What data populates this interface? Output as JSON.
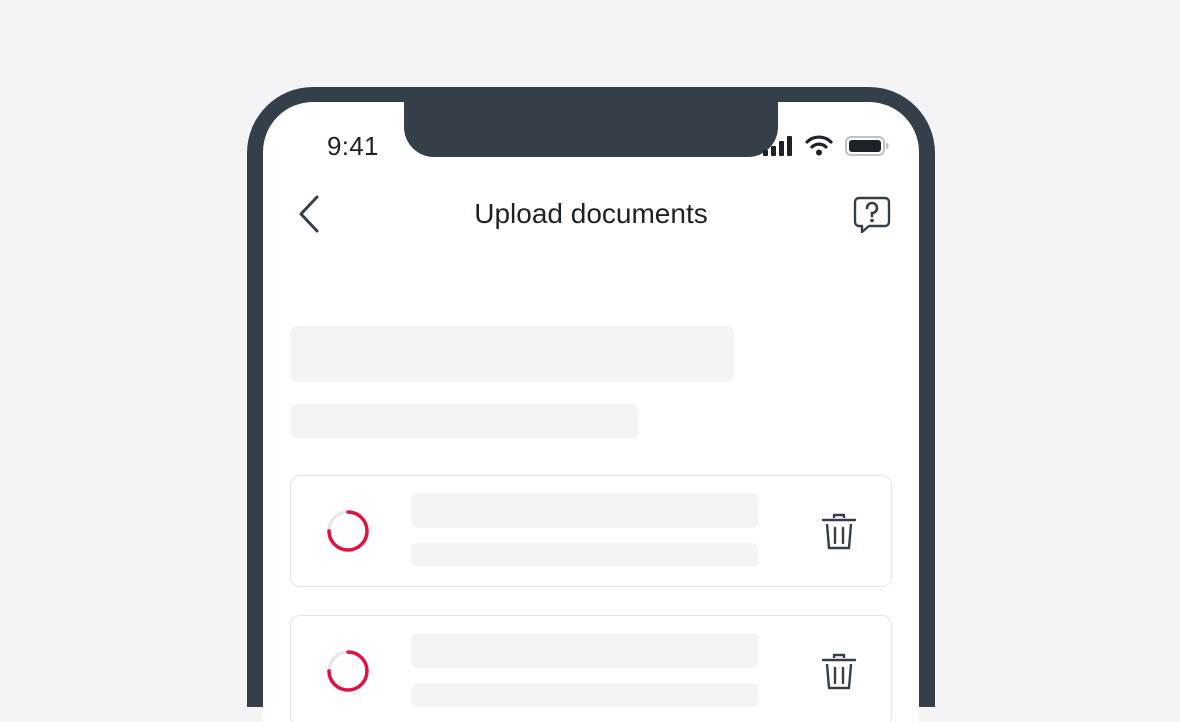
{
  "status_bar": {
    "time": "9:41"
  },
  "header": {
    "title": "Upload documents"
  },
  "icons": {
    "back": "chevron-left-icon",
    "help": "help-chat-icon",
    "delete": "trash-icon",
    "signal": "cellular-signal-icon",
    "wifi": "wifi-icon",
    "battery": "battery-icon"
  },
  "colors": {
    "background": "#f4f4f6",
    "phone_frame": "#353f4a",
    "accent": "#e0123f",
    "skeleton": "#f4f4f6",
    "card_border": "#e4e4e7"
  },
  "documents": [
    {
      "state": "uploading",
      "progress": 0.75
    },
    {
      "state": "uploading",
      "progress": 0.75
    }
  ]
}
